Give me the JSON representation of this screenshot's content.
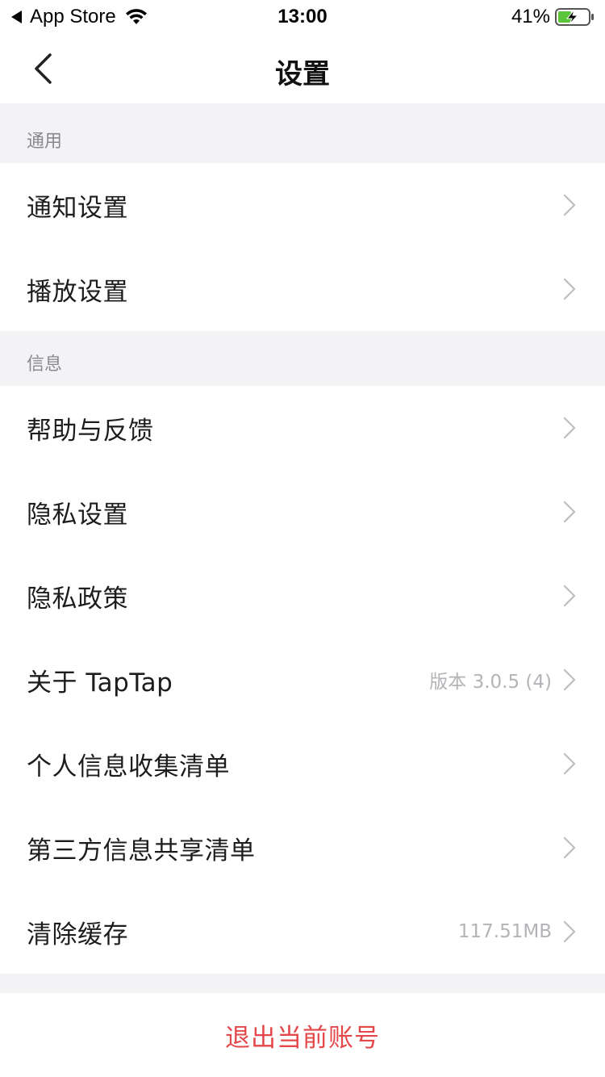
{
  "status_bar": {
    "back_app": "App Store",
    "time": "13:00",
    "battery": "41%"
  },
  "nav": {
    "title": "设置"
  },
  "sections": [
    {
      "header": "通用",
      "items": [
        {
          "label": "通知设置",
          "value": ""
        },
        {
          "label": "播放设置",
          "value": ""
        }
      ]
    },
    {
      "header": "信息",
      "items": [
        {
          "label": "帮助与反馈",
          "value": ""
        },
        {
          "label": "隐私设置",
          "value": ""
        },
        {
          "label": "隐私政策",
          "value": ""
        },
        {
          "label": "关于 TapTap",
          "value": "版本 3.0.5 (4)"
        },
        {
          "label": "个人信息收集清单",
          "value": ""
        },
        {
          "label": "第三方信息共享清单",
          "value": ""
        },
        {
          "label": "清除缓存",
          "value": "117.51MB"
        }
      ]
    }
  ],
  "logout": {
    "label": "退出当前账号"
  },
  "colors": {
    "logout_text": "#e4474a",
    "background": "#f3f3f5"
  }
}
